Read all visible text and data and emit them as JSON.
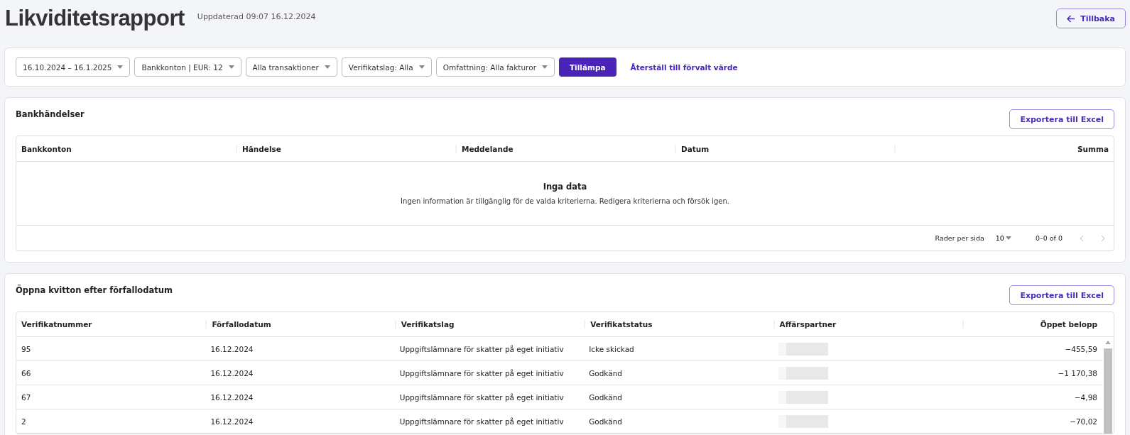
{
  "header": {
    "title": "Likviditetsrapport",
    "updated": "Uppdaterad 09:07 16.12.2024",
    "back_button": "Tillbaka"
  },
  "filters": {
    "dropdowns": [
      "16.10.2024 – 16.1.2025",
      "Bankkonton | EUR: 12",
      "Alla transaktioner",
      "Verifikatslag: Alla",
      "Omfattning: Alla fakturor"
    ],
    "apply_button": "Tillämpa",
    "reset_link": "Återställ till förvalt värde"
  },
  "bank_events": {
    "title": "Bankhändelser",
    "export_button": "Exportera till Excel",
    "columns": [
      "Bankkonton",
      "Händelse",
      "Meddelande",
      "Datum",
      "Summa"
    ],
    "empty_title": "Inga data",
    "empty_message": "Ingen information är tillgänglig för de valda kriterierna. Redigera kriterierna och försök igen.",
    "pagination": {
      "rows_label": "Rader per sida",
      "rows_value": "10",
      "range": "0–0 of 0"
    }
  },
  "open_receipts": {
    "title": "Öppna kvitton efter förfallodatum",
    "export_button": "Exportera till Excel",
    "columns": [
      "Verifikatnummer",
      "Förfallodatum",
      "Verifikatslag",
      "Verifikatstatus",
      "Affärspartner",
      "Öppet belopp"
    ],
    "rows": [
      {
        "number": "95",
        "due": "16.12.2024",
        "type": "Uppgiftslämnare för skatter på eget initiativ",
        "status": "Icke skickad",
        "amount": "−455,59"
      },
      {
        "number": "66",
        "due": "16.12.2024",
        "type": "Uppgiftslämnare för skatter på eget initiativ",
        "status": "Godkänd",
        "amount": "−1 170,38"
      },
      {
        "number": "67",
        "due": "16.12.2024",
        "type": "Uppgiftslämnare för skatter på eget initiativ",
        "status": "Godkänd",
        "amount": "−4,98"
      },
      {
        "number": "2",
        "due": "16.12.2024",
        "type": "Uppgiftslämnare för skatter på eget initiativ",
        "status": "Godkänd",
        "amount": "−70,02"
      }
    ]
  }
}
